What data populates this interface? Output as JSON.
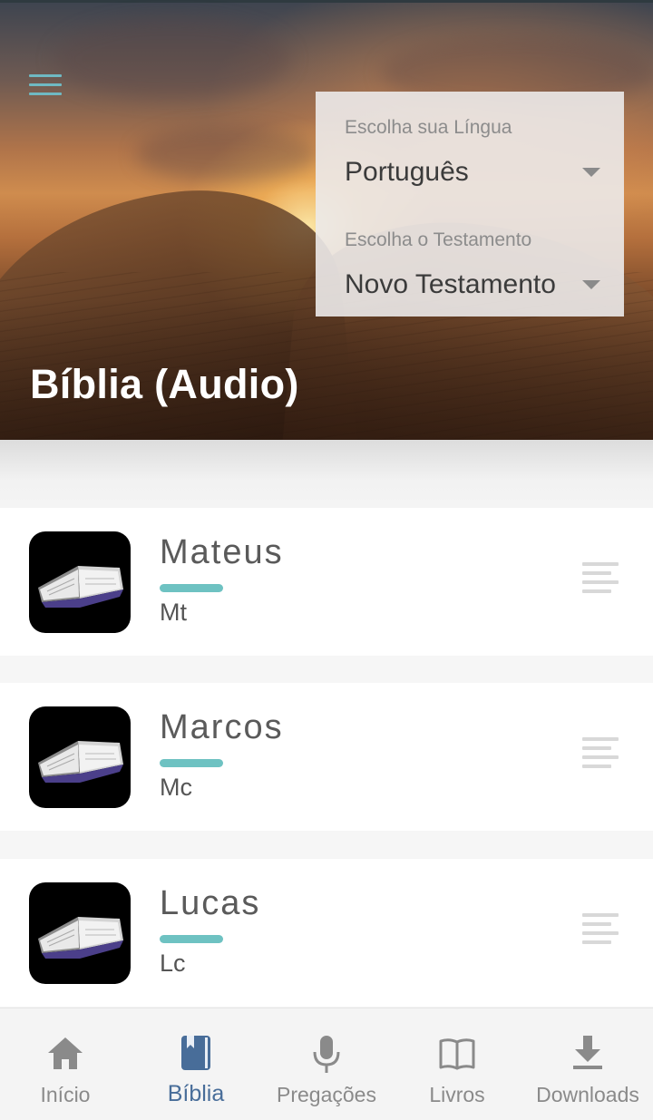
{
  "header": {
    "title": "Bíblia (Audio)",
    "menu_icon": "hamburger-menu-icon"
  },
  "selectors": {
    "language_label": "Escolha sua Língua",
    "language_value": "Português",
    "testament_label": "Escolha o Testamento",
    "testament_value": "Novo Testamento"
  },
  "books": [
    {
      "name": "Mateus",
      "abbr": "Mt"
    },
    {
      "name": "Marcos",
      "abbr": "Mc"
    },
    {
      "name": "Lucas",
      "abbr": "Lc"
    }
  ],
  "bottom_nav": [
    {
      "label": "Início",
      "icon": "home-icon",
      "active": false
    },
    {
      "label": "Bíblia",
      "icon": "bible-icon",
      "active": true
    },
    {
      "label": "Pregações",
      "icon": "microphone-icon",
      "active": false
    },
    {
      "label": "Livros",
      "icon": "open-book-icon",
      "active": false
    },
    {
      "label": "Downloads",
      "icon": "download-icon",
      "active": false
    }
  ],
  "colors": {
    "accent": "#6ec2c2",
    "active_nav": "#486d99",
    "inactive_nav": "#8a8a8a"
  }
}
